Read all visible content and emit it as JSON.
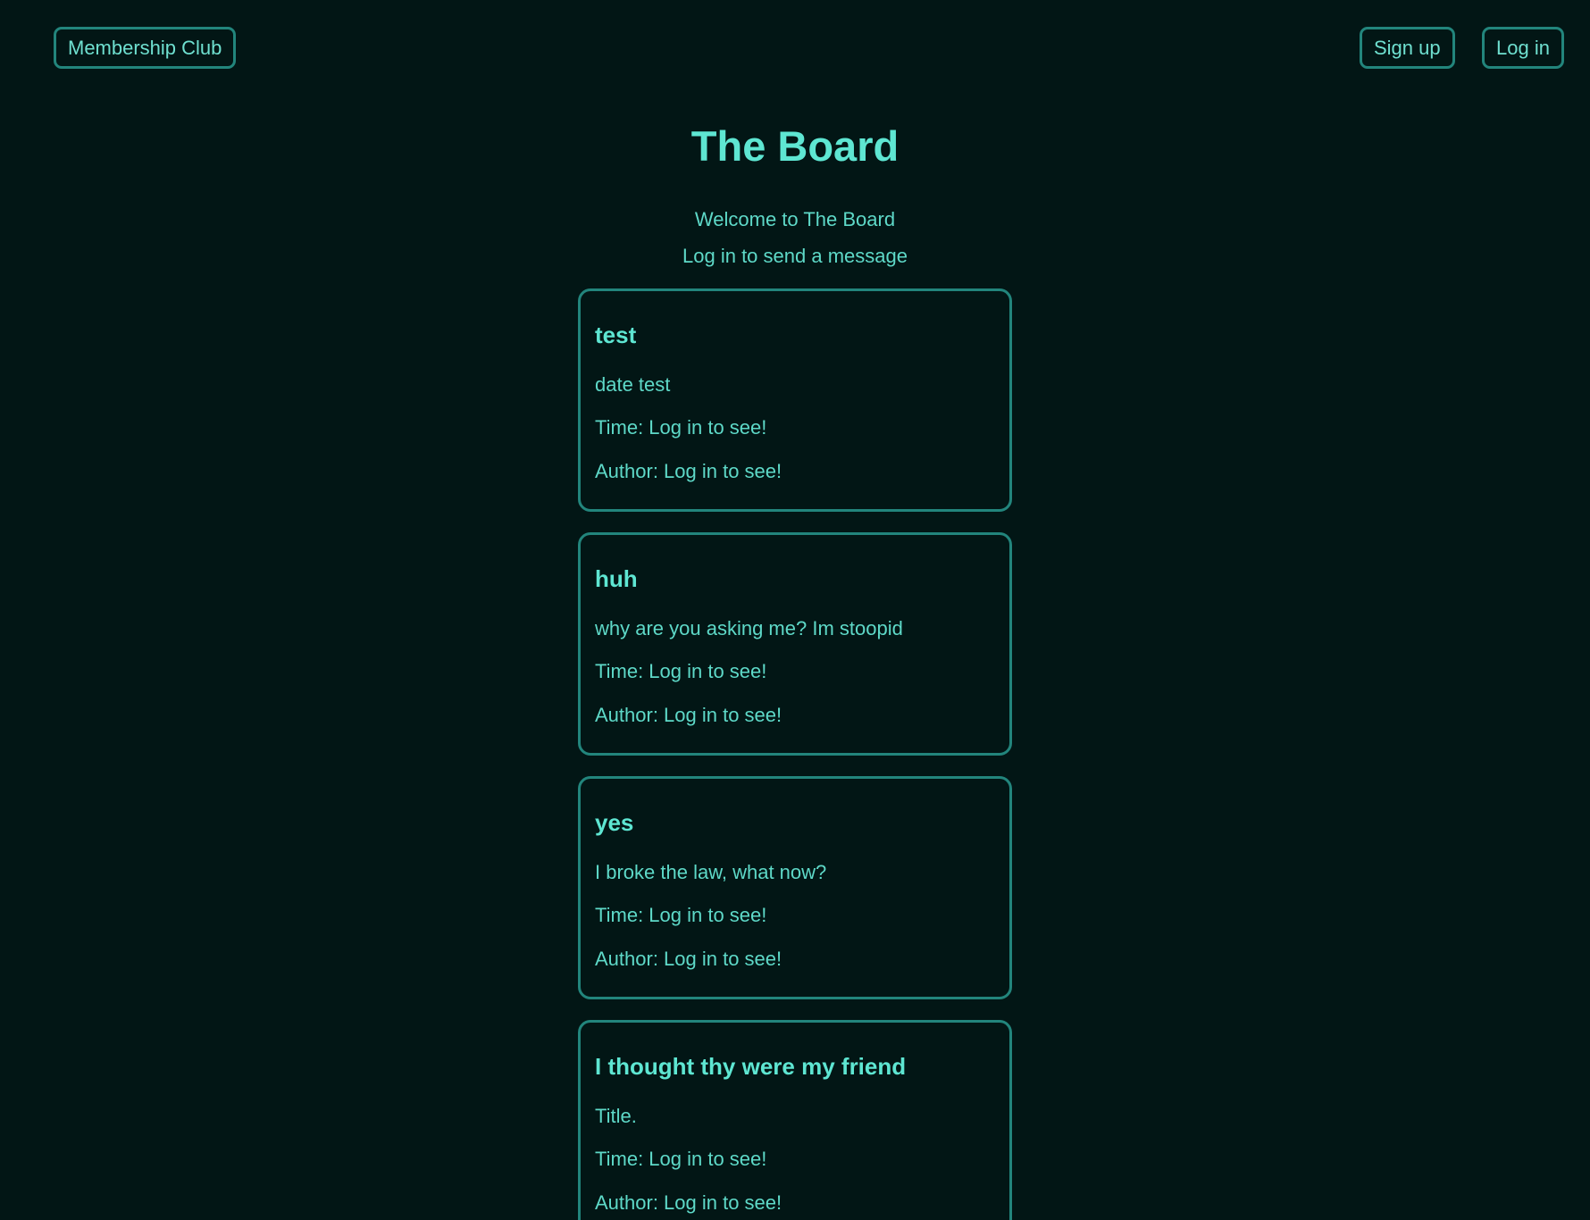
{
  "header": {
    "brand": "Membership Club",
    "signup": "Sign up",
    "login": "Log in"
  },
  "main": {
    "title": "The Board",
    "welcome": "Welcome to The Board",
    "hint": "Log in to send a message"
  },
  "messages": [
    {
      "title": "test",
      "body": "date test",
      "time": "Time: Log in to see!",
      "author": "Author: Log in to see!"
    },
    {
      "title": "huh",
      "body": "why are you asking me? Im stoopid",
      "time": "Time: Log in to see!",
      "author": "Author: Log in to see!"
    },
    {
      "title": "yes",
      "body": "I broke the law, what now?",
      "time": "Time: Log in to see!",
      "author": "Author: Log in to see!"
    },
    {
      "title": "I thought thy were my friend",
      "body": "Title.",
      "time": "Time: Log in to see!",
      "author": "Author: Log in to see!"
    }
  ],
  "colors": {
    "background": "#021615",
    "accent": "#5ee0cf",
    "border": "#22857c"
  }
}
